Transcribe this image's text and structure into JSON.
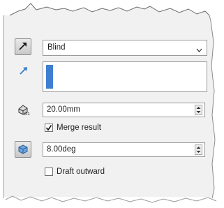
{
  "end_condition": {
    "selected_value": "Blind"
  },
  "depth": {
    "value": "20.00mm"
  },
  "merge_result": {
    "label": "Merge result",
    "checked": true
  },
  "draft": {
    "angle_value": "8.00deg",
    "outward_label": "Draft outward",
    "outward_checked": false
  },
  "icons": [
    "reverse-direction-icon",
    "direction-arrow-icon",
    "depth-icon",
    "draft-icon"
  ],
  "colors": {
    "selection_bar": "#3f7fd2",
    "panel_bg": "#f1f1f1"
  }
}
